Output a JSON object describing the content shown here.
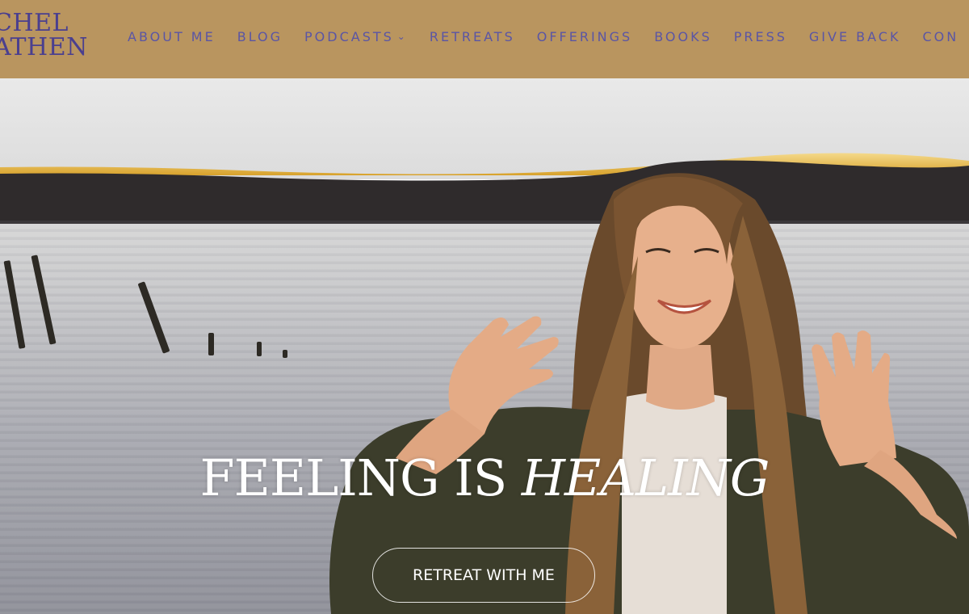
{
  "brand": {
    "logo_line1": "CHEL",
    "logo_line2": "ATHEN"
  },
  "nav": {
    "items": [
      {
        "label": "ABOUT ME"
      },
      {
        "label": "BLOG"
      },
      {
        "label": "PODCASTS",
        "has_dropdown": true
      },
      {
        "label": "RETREATS"
      },
      {
        "label": "OFFERINGS"
      },
      {
        "label": "BOOKS"
      },
      {
        "label": "PRESS"
      },
      {
        "label": "GIVE BACK"
      },
      {
        "label": "CON"
      }
    ],
    "dropdown_icon": "chevron-down-icon"
  },
  "hero": {
    "headline_part1": "FEELING IS ",
    "headline_part2": "HEALING",
    "cta_label": "RETREAT WITH ME"
  },
  "colors": {
    "header_bg": "#b9955f",
    "nav_text": "#5a55a5",
    "logo_text": "#4a3f8f"
  }
}
